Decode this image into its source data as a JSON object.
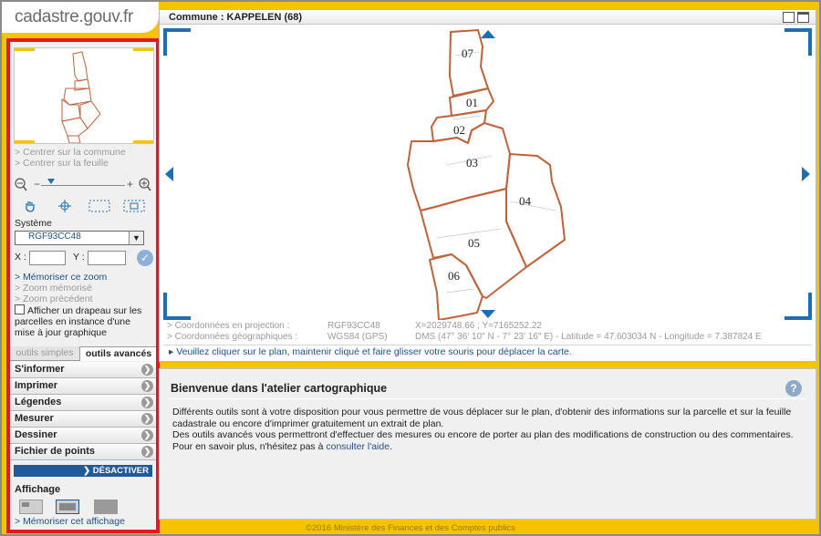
{
  "site": {
    "logo_text": "cadastre.gouv.fr"
  },
  "sidebar": {
    "center_commune": "> Centrer sur la commune",
    "center_sheet": "> Centrer sur la feuille",
    "zoom_minus": "−",
    "zoom_plus": "+",
    "system_label": "Système",
    "system_value": "RGF93CC48",
    "x_label": "X :",
    "y_label": "Y :",
    "memorize_zoom": "> Mémoriser ce zoom",
    "zoom_memorized": "> Zoom mémorisé",
    "zoom_previous": "> Zoom précédent",
    "flag_label": "Afficher un drapeau sur les parcelles en instance d'une mise à jour graphique",
    "tab_simple": "outils simples",
    "tab_advanced": "outils avancés",
    "menu": [
      "S'informer",
      "Imprimer",
      "Légendes",
      "Mesurer",
      "Dessiner",
      "Fichier de points"
    ],
    "deactivate": "❯ DÉSACTIVER",
    "affichage_label": "Affichage",
    "memorize_display": "> Mémoriser cet affichage"
  },
  "map": {
    "title": "Commune : KAPPELEN (68)",
    "sheet_labels": [
      "07",
      "01",
      "02",
      "03",
      "04",
      "05",
      "06"
    ],
    "proj_label": "> Coordonnées en projection :",
    "proj_system": "RGF93CC48",
    "proj_value": "X=2029748.66 ; Y=7165252.22",
    "geo_label": "> Coordonnées géographiques :",
    "geo_system": "WGS84 (GPS)",
    "geo_value": "DMS (47° 36' 10\" N - 7° 23' 16\" E) - Latitude = 47.603034 N - Longitude = 7.387824 E",
    "hint": "▸ Veuillez cliquer sur le plan, maintenir cliqué et faire glisser votre souris pour déplacer la carte."
  },
  "welcome": {
    "title": "Bienvenue dans l'atelier cartographique",
    "line1": "Différents outils sont à votre disposition pour vous permettre de vous déplacer sur le plan, d'obtenir des informations sur la parcelle et sur la feuille cadastrale ou encore d'imprimer gratuitement un extrait de plan.",
    "line2": "Des outils avancés vous permettront d'effectuer des mesures ou encore de porter au plan des modifications de construction ou des commentaires.",
    "line3_prefix": "Pour en savoir plus, n'hésitez pas à ",
    "help_link": "consulter l'aide",
    "line3_suffix": "."
  },
  "footer": {
    "text": "©2016 Ministère des Finances et des Comptes publics"
  },
  "colors": {
    "brand_yellow": "#f5c400",
    "highlight_red": "#e8171c",
    "link_blue": "#1e4f8c",
    "parcel_stroke": "#c0623a"
  }
}
